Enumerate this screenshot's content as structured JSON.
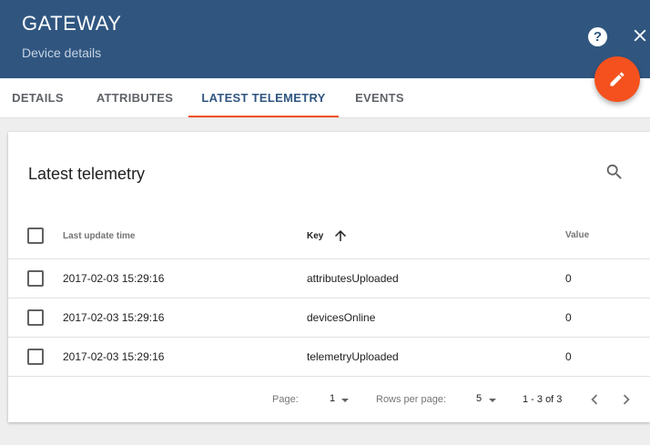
{
  "header": {
    "title": "GATEWAY",
    "subtitle": "Device details",
    "help_label": "?"
  },
  "tabs": [
    {
      "label": "DETAILS"
    },
    {
      "label": "ATTRIBUTES"
    },
    {
      "label": "LATEST TELEMETRY",
      "active": true
    },
    {
      "label": "EVENTS"
    }
  ],
  "card": {
    "title": "Latest telemetry"
  },
  "table": {
    "columns": [
      {
        "label": "Last update time"
      },
      {
        "label": "Key",
        "sorted": "ascending"
      },
      {
        "label": "Value"
      }
    ],
    "rows": [
      {
        "time": "2017-02-03 15:29:16",
        "key": "attributesUploaded",
        "value": "0"
      },
      {
        "time": "2017-02-03 15:29:16",
        "key": "devicesOnline",
        "value": "0"
      },
      {
        "time": "2017-02-03 15:29:16",
        "key": "telemetryUploaded",
        "value": "0"
      }
    ]
  },
  "pagination": {
    "page_label": "Page:",
    "page_value": "1",
    "rows_per_page_label": "Rows per page:",
    "rows_per_page_value": "5",
    "range": "1 - 3 of 3"
  },
  "colors": {
    "header_bg": "#305680",
    "accent": "#f4511e"
  },
  "icons": [
    "help-icon",
    "close-icon",
    "edit-icon",
    "search-icon",
    "arrow-up-icon",
    "chevron-left-icon",
    "chevron-right-icon"
  ]
}
